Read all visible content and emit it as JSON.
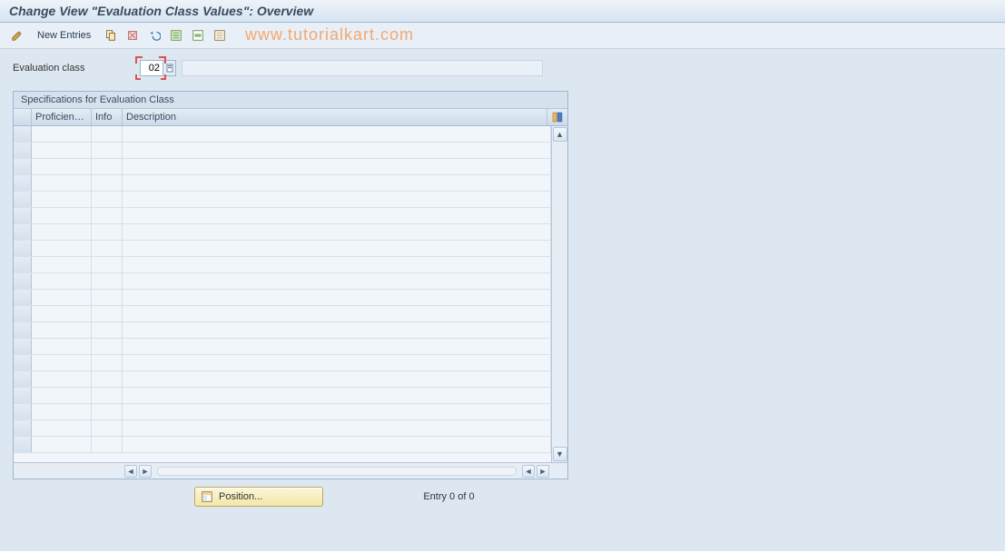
{
  "header": {
    "title": "Change View \"Evaluation Class Values\": Overview"
  },
  "toolbar": {
    "new_entries_label": "New Entries"
  },
  "form": {
    "evaluation_class_label": "Evaluation class",
    "evaluation_class_value": "02",
    "evaluation_class_desc": ""
  },
  "table": {
    "panel_title": "Specifications for Evaluation Class",
    "columns": {
      "proficiency": "Proficien…",
      "info": "Info",
      "description": "Description"
    },
    "rows": [
      {
        "proficiency": "",
        "info": "",
        "description": ""
      },
      {
        "proficiency": "",
        "info": "",
        "description": ""
      },
      {
        "proficiency": "",
        "info": "",
        "description": ""
      },
      {
        "proficiency": "",
        "info": "",
        "description": ""
      },
      {
        "proficiency": "",
        "info": "",
        "description": ""
      },
      {
        "proficiency": "",
        "info": "",
        "description": ""
      },
      {
        "proficiency": "",
        "info": "",
        "description": ""
      },
      {
        "proficiency": "",
        "info": "",
        "description": ""
      },
      {
        "proficiency": "",
        "info": "",
        "description": ""
      },
      {
        "proficiency": "",
        "info": "",
        "description": ""
      },
      {
        "proficiency": "",
        "info": "",
        "description": ""
      },
      {
        "proficiency": "",
        "info": "",
        "description": ""
      },
      {
        "proficiency": "",
        "info": "",
        "description": ""
      },
      {
        "proficiency": "",
        "info": "",
        "description": ""
      },
      {
        "proficiency": "",
        "info": "",
        "description": ""
      },
      {
        "proficiency": "",
        "info": "",
        "description": ""
      },
      {
        "proficiency": "",
        "info": "",
        "description": ""
      },
      {
        "proficiency": "",
        "info": "",
        "description": ""
      },
      {
        "proficiency": "",
        "info": "",
        "description": ""
      },
      {
        "proficiency": "",
        "info": "",
        "description": ""
      }
    ]
  },
  "footer": {
    "position_label": "Position...",
    "entry_text": "Entry 0 of 0"
  },
  "watermark": "www.tutorialkart.com"
}
